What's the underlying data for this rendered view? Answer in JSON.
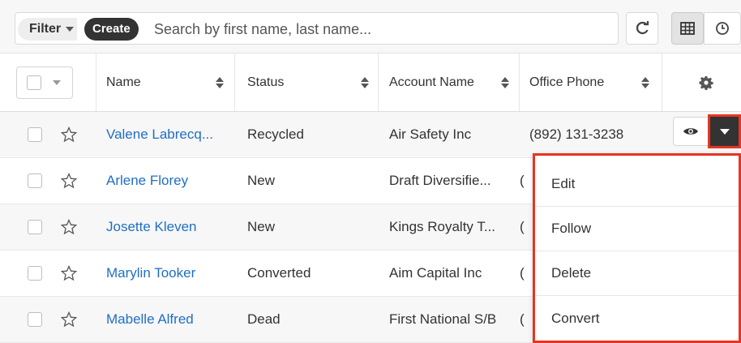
{
  "toolbar": {
    "filter_label": "Filter",
    "create_label": "Create",
    "search_placeholder": "Search by first name, last name..."
  },
  "table": {
    "columns": [
      "Name",
      "Status",
      "Account Name",
      "Office Phone"
    ],
    "rows": [
      {
        "name": "Valene Labrecq...",
        "status": "Recycled",
        "account": "Air Safety Inc",
        "phone": "(892) 131-3238"
      },
      {
        "name": "Arlene Florey",
        "status": "New",
        "account": "Draft Diversifie...",
        "phone": "("
      },
      {
        "name": "Josette Kleven",
        "status": "New",
        "account": "Kings Royalty T...",
        "phone": "("
      },
      {
        "name": "Marylin Tooker",
        "status": "Converted",
        "account": "Aim Capital Inc",
        "phone": "("
      },
      {
        "name": "Mabelle Alfred",
        "status": "Dead",
        "account": "First National S/B",
        "phone": "("
      }
    ]
  },
  "row_actions": {
    "menu": [
      "Edit",
      "Follow",
      "Delete",
      "Convert"
    ]
  },
  "colors": {
    "link": "#1f6fc5",
    "highlight": "#e53523",
    "dark_button": "#333333"
  }
}
